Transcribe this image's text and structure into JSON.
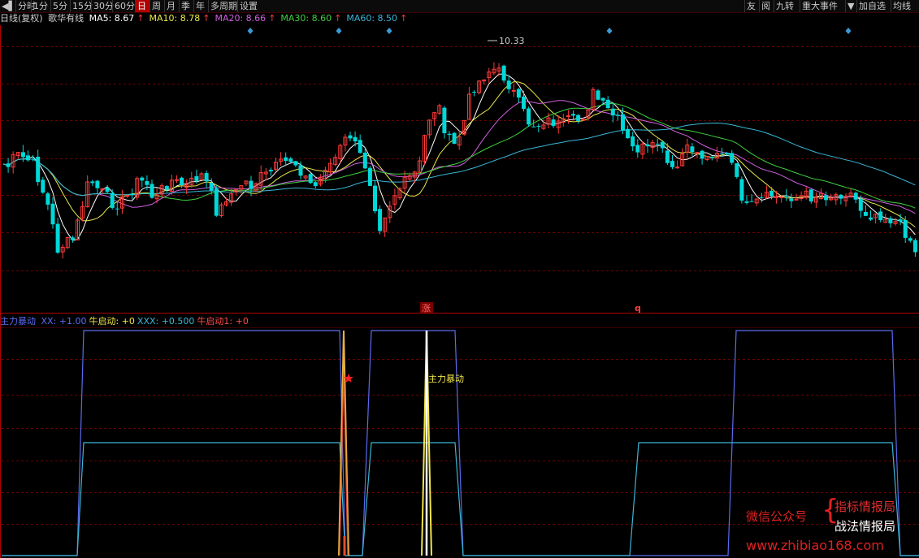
{
  "toolbar": {
    "left_items": [
      {
        "label": "分时",
        "active": false
      },
      {
        "label": "1分",
        "active": false
      },
      {
        "label": "5分",
        "active": false
      },
      {
        "label": "15分",
        "active": false
      },
      {
        "label": "30分",
        "active": false
      },
      {
        "label": "60分",
        "active": false
      },
      {
        "label": "日",
        "active": true
      },
      {
        "label": "周",
        "active": false
      },
      {
        "label": "月",
        "active": false
      },
      {
        "label": "季",
        "active": false
      },
      {
        "label": "年",
        "active": false
      },
      {
        "label": "多周期",
        "active": false
      },
      {
        "label": "设置",
        "active": false
      }
    ],
    "right_items": [
      {
        "label": "友"
      },
      {
        "label": "阅"
      },
      {
        "label": "九转"
      },
      {
        "label": "重大事件"
      },
      {
        "label": "▼"
      },
      {
        "label": "加自选"
      },
      {
        "label": "均线"
      }
    ]
  },
  "main_panel": {
    "period": "日线(复权)",
    "stock_name": "歌华有线",
    "ma_lines": [
      {
        "label": "MA5:",
        "value": "8.67",
        "arrow": "↑",
        "color": "#ffffff"
      },
      {
        "label": "MA10:",
        "value": "8.78",
        "arrow": "↑",
        "color": "#e8e84a"
      },
      {
        "label": "MA20:",
        "value": "8.66",
        "arrow": "↑",
        "color": "#d060e0"
      },
      {
        "label": "MA30:",
        "value": "8.60",
        "arrow": "↑",
        "color": "#40d040"
      },
      {
        "label": "MA60:",
        "value": "8.50",
        "arrow": "↑",
        "color": "#3ab6d6"
      }
    ],
    "high_marker": "10.33",
    "signal_zhang": "涨",
    "signal_q": "q"
  },
  "indicator_panel": {
    "title": "主力暴动",
    "params": [
      {
        "label": "XX:",
        "value": "+1.00",
        "color": "#5a6cf0"
      },
      {
        "label": "牛启动:",
        "value": "+0",
        "color": "#f0e64a"
      },
      {
        "label": "XXX:",
        "value": "+0.500",
        "color": "#3ab6d6"
      },
      {
        "label": "牛启动1:",
        "value": "+0",
        "color": "#ff4a4a"
      }
    ],
    "annotation": "主力暴动"
  },
  "watermark": {
    "wechat": "微信公众号",
    "line1": "指标情报局",
    "line2": "战法情报局",
    "url": "www.zhibiao168.com"
  },
  "colors": {
    "up": "#ff3a3a",
    "down": "#00d8d8",
    "grid": "#6b0000",
    "border": "#b00000",
    "diamond": "#3a9ad6"
  }
}
